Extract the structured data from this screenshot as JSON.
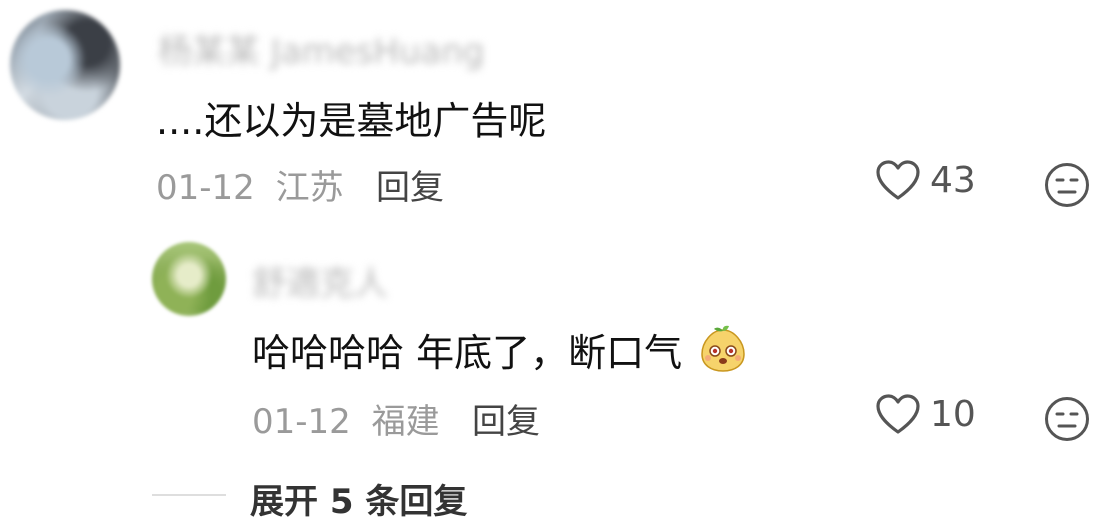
{
  "comment": {
    "username": "杨某某 JamesHuang",
    "text": "....还以为是墓地广告呢",
    "date": "01-12",
    "location": "江苏",
    "reply_label": "回复",
    "likes": "43"
  },
  "reply": {
    "username": "舒適克人",
    "text": "哈哈哈哈 年底了，断口气",
    "emoji": "laughing-mango-emoji",
    "date": "01-12",
    "location": "福建",
    "reply_label": "回复",
    "likes": "10"
  },
  "expand": {
    "label": "展开 5 条回复"
  },
  "icons": {
    "like": "heart-outline-icon",
    "dislike": "neutral-face-icon"
  },
  "colors": {
    "meta_text": "#9a9a9a",
    "body_text": "#111111",
    "emoji_body": "#f6d36b",
    "emoji_leaf": "#74c04a"
  }
}
